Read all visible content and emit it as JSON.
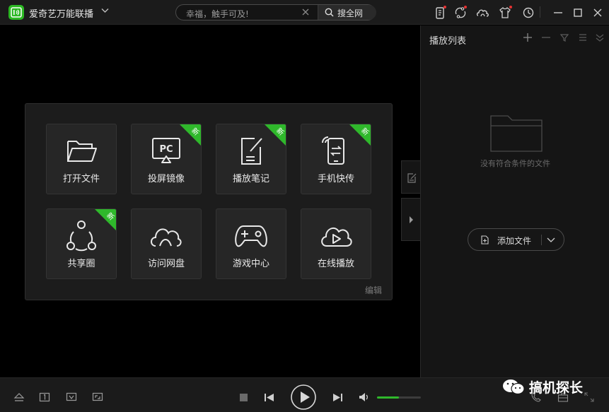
{
  "app": {
    "title": "爱奇艺万能联播"
  },
  "search": {
    "placeholder": "幸福，触手可及!",
    "button_label": "搜全网"
  },
  "tiles": [
    {
      "label": "打开文件",
      "badge": ""
    },
    {
      "label": "投屏镜像",
      "badge": "新"
    },
    {
      "label": "播放笔记",
      "badge": "新"
    },
    {
      "label": "手机快传",
      "badge": "新"
    },
    {
      "label": "共享圈",
      "badge": "新"
    },
    {
      "label": "访问网盘",
      "badge": ""
    },
    {
      "label": "游戏中心",
      "badge": ""
    },
    {
      "label": "在线播放",
      "badge": ""
    }
  ],
  "panel": {
    "edit_label": "编辑"
  },
  "playlist": {
    "title": "播放列表",
    "empty_text": "没有符合条件的文件",
    "add_file_label": "添加文件"
  },
  "player": {
    "volume_level": 0.5
  },
  "watermark": {
    "text": "搞机探长"
  },
  "colors": {
    "accent": "#2fb82b",
    "notify": "#e63232",
    "background": "#000000",
    "panel": "#1c1c1c"
  }
}
